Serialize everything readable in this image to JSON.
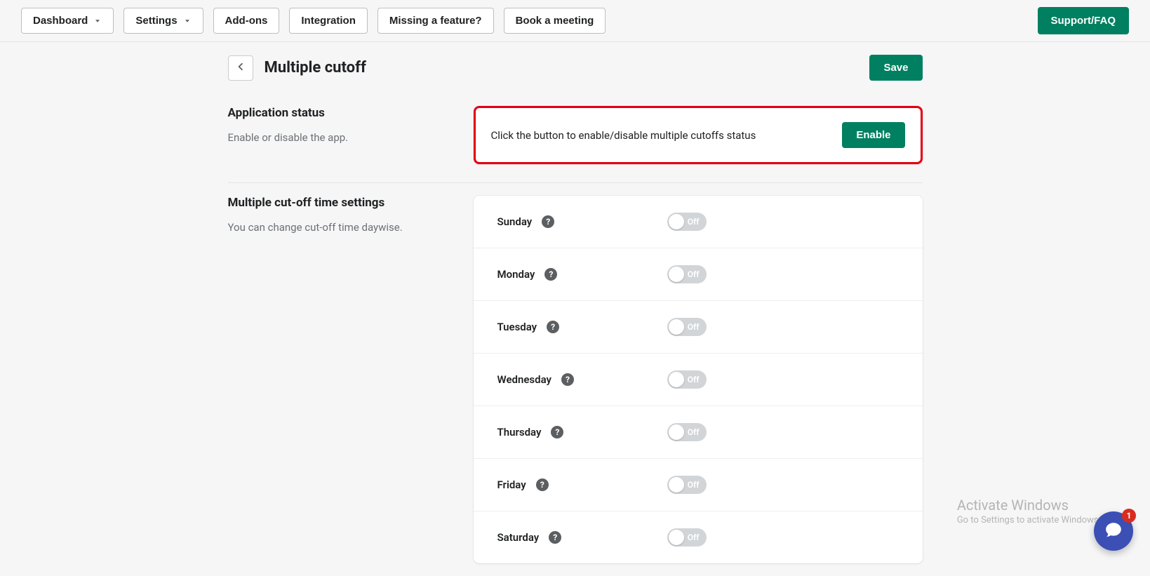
{
  "nav": {
    "dashboard": "Dashboard",
    "settings": "Settings",
    "addons": "Add-ons",
    "integration": "Integration",
    "missing": "Missing a feature?",
    "book": "Book a meeting",
    "support": "Support/FAQ"
  },
  "header": {
    "title": "Multiple cutoff",
    "save": "Save"
  },
  "status": {
    "heading": "Application status",
    "desc": "Enable or disable the app.",
    "text": "Click the button to enable/disable multiple cutoffs status",
    "button": "Enable"
  },
  "cutoff": {
    "heading": "Multiple cut-off time settings",
    "desc": "You can change cut-off time daywise.",
    "off_label": "Off",
    "days": [
      {
        "name": "Sunday"
      },
      {
        "name": "Monday"
      },
      {
        "name": "Tuesday"
      },
      {
        "name": "Wednesday"
      },
      {
        "name": "Thursday"
      },
      {
        "name": "Friday"
      },
      {
        "name": "Saturday"
      }
    ]
  },
  "watermark": {
    "l1": "Activate Windows",
    "l2": "Go to Settings to activate Windows."
  },
  "chat": {
    "badge": "1"
  }
}
